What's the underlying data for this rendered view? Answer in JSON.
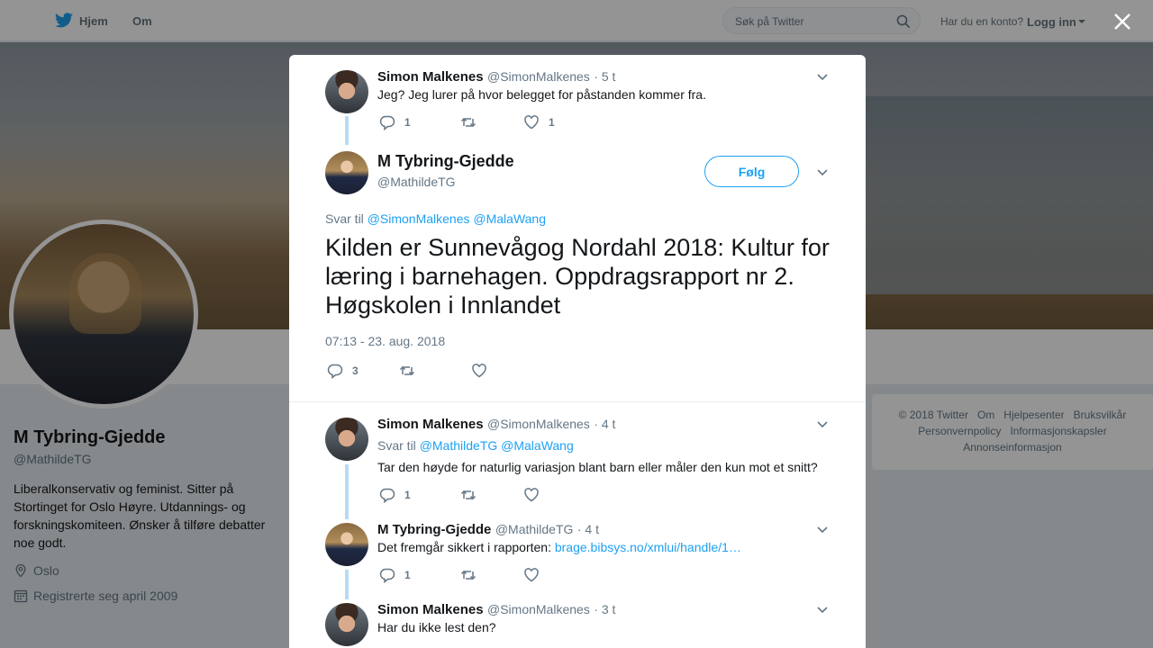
{
  "topbar": {
    "home_label": "Hjem",
    "about_label": "Om",
    "search_placeholder": "Søk på Twitter",
    "account_question": "Har du en konto?",
    "login_label": "Logg inn"
  },
  "profile": {
    "name": "M Tybring-Gjedde",
    "handle": "@MathildeTG",
    "bio": "Liberalkonservativ og feminist. Sitter på Stortinget for Oslo Høyre. Utdannings- og forskningskomiteen. Ønsker å tilføre debatter noe godt.",
    "location": "Oslo",
    "joined": "Registrerte seg april 2009"
  },
  "footer": {
    "links": [
      "© 2018 Twitter",
      "Om",
      "Hjelpesenter",
      "Bruksvilkår",
      "Personvernpolicy",
      "Informasjonskapsler",
      "Annonseinformasjon"
    ]
  },
  "modal": {
    "parent_tweet": {
      "name": "Simon Malkenes",
      "handle": "@SimonMalkenes",
      "time": "· 5 t",
      "text": "Jeg? Jeg lurer på hvor belegget for påstanden kommer fra.",
      "replies": "1",
      "likes": "1"
    },
    "main_tweet": {
      "name": "M Tybring-Gjedde",
      "handle": "@MathildeTG",
      "follow_label": "Følg",
      "reply_prefix": "Svar til",
      "reply_mentions": "@SimonMalkenes @MalaWang",
      "text": "Kilden er Sunnevågog Nordahl 2018: Kultur for læring i barnehagen. Oppdragsrapport nr 2. Høgskolen i Innlandet",
      "timestamp": "07:13 - 23. aug. 2018",
      "replies": "3"
    },
    "replies": [
      {
        "name": "Simon Malkenes",
        "handle": "@SimonMalkenes",
        "time": "· 4 t",
        "reply_prefix": "Svar til",
        "reply_mentions": "@MathildeTG @MalaWang",
        "text": "Tar den høyde for naturlig variasjon blant barn eller måler den kun mot et snitt?",
        "replies": "1"
      },
      {
        "name": "M Tybring-Gjedde",
        "handle": "@MathildeTG",
        "time": "· 4 t",
        "text_prefix": "Det fremgår sikkert i rapporten:",
        "link": "brage.bibsys.no/xmlui/handle/1…",
        "replies": "1"
      },
      {
        "name": "Simon Malkenes",
        "handle": "@SimonMalkenes",
        "time": "· 3 t",
        "text": "Har du ikke lest den?"
      }
    ]
  }
}
